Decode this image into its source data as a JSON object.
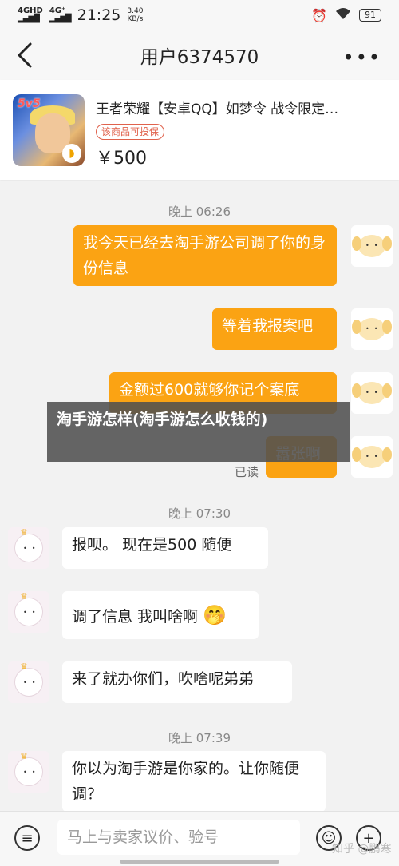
{
  "status_bar": {
    "signal1": "4GHD",
    "signal2": "4G⁺",
    "time": "21:25",
    "speed_value": "3.40",
    "speed_unit": "KB/s",
    "battery": "91"
  },
  "header": {
    "title": "用户6374570"
  },
  "product": {
    "title": "王者荣耀【安卓QQ】如梦令 战令限定…",
    "tag": "该商品可投保",
    "price": "￥500",
    "logo_text": "5v5"
  },
  "chat": {
    "time1": "晚上 06:26",
    "time2": "晚上 07:30",
    "time3": "晚上 07:39",
    "msg1": "我今天已经去淘手游公司调了你的身份信息",
    "msg2": "等着我报案吧",
    "msg3": "金额过600就够你记个案底",
    "msg4": "嚣张啊",
    "read": "已读",
    "reply1": "报呗。 现在是500 随便",
    "reply2": "调了信息 我叫啥啊",
    "reply2_emoji": "🤭",
    "reply3": "来了就办你们，吹啥呢弟弟",
    "reply4": "你以为淘手游是你家的。让你随便调？"
  },
  "overlay": {
    "text": "淘手游怎样(淘手游怎么收钱的)"
  },
  "input_bar": {
    "placeholder": "马上与卖家议价、验号",
    "watermark": "知乎 @鹏寒"
  },
  "colors": {
    "outgoing_bubble": "#fba313",
    "incoming_bubble": "#ffffff",
    "background": "#f2f2f2",
    "tag_color": "#e0624c"
  }
}
